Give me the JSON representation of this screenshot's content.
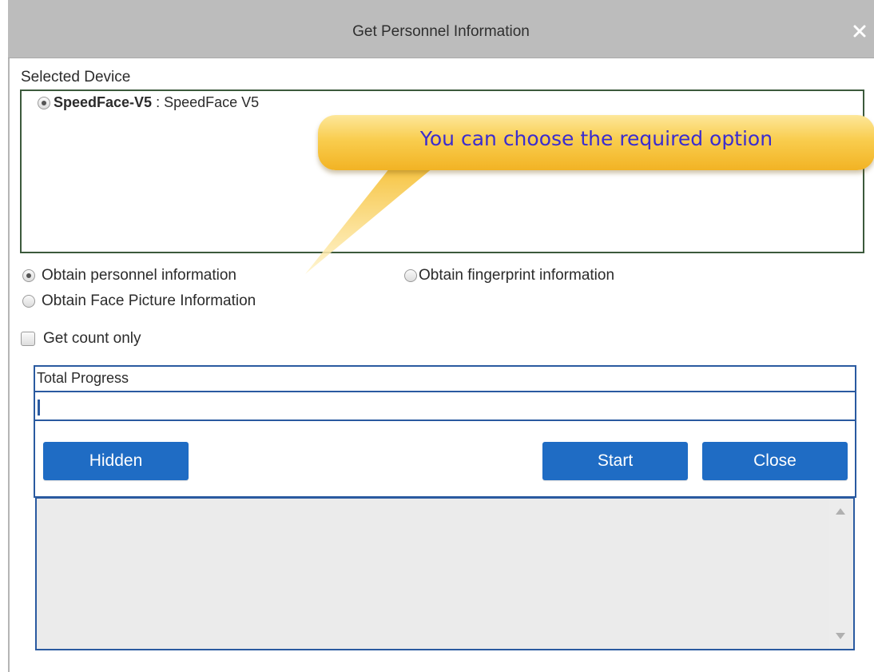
{
  "dialog": {
    "title": "Get Personnel Information",
    "close_icon": "close-icon",
    "accent_color": "#1f6cc4",
    "titlebar_color": "#bcbcbc"
  },
  "devices": {
    "label": "Selected Device",
    "items": [
      {
        "name": "SpeedFace-V5",
        "separator": " : ",
        "model": "SpeedFace V5",
        "selected": true
      }
    ]
  },
  "callout": {
    "text": "You can choose the required option",
    "color": "#f9cd4e",
    "text_color": "#3b2ccf"
  },
  "options": {
    "personnel": {
      "label": "Obtain personnel information",
      "selected": true
    },
    "fingerprint": {
      "label": "Obtain fingerprint information",
      "selected": false
    },
    "face": {
      "label": "Obtain Face Picture Information",
      "selected": false
    }
  },
  "count_only": {
    "label": "Get count only",
    "checked": false
  },
  "progress": {
    "label": "Total Progress",
    "value": 0
  },
  "buttons": {
    "hidden": "Hidden",
    "start": "Start",
    "close": "Close"
  }
}
